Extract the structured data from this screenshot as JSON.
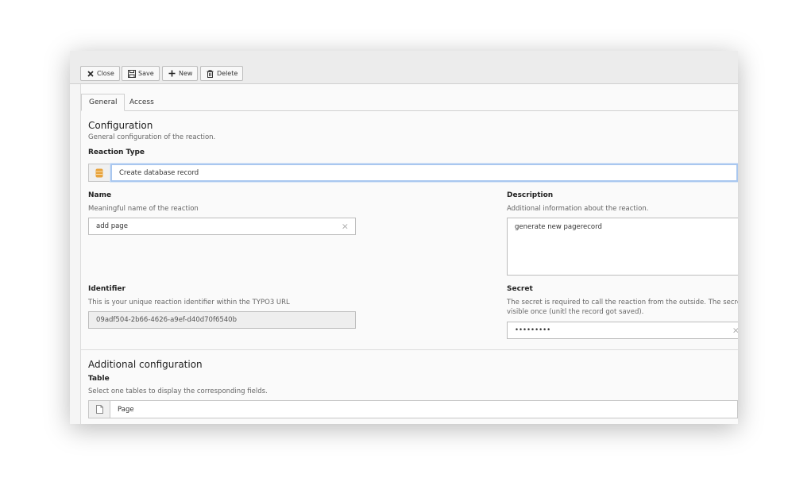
{
  "toolbar": {
    "close_label": "Close",
    "save_label": "Save",
    "new_label": "New",
    "delete_label": "Delete"
  },
  "tabs": [
    {
      "label": "General",
      "active": true
    },
    {
      "label": "Access",
      "active": false
    }
  ],
  "configuration": {
    "title": "Configuration",
    "subtitle": "General configuration of the reaction.",
    "reaction_type": {
      "label": "Reaction Type",
      "value": "Create database record",
      "icon": "database-icon"
    },
    "name": {
      "label": "Name",
      "description": "Meaningful name of the reaction",
      "value": "add page"
    },
    "description": {
      "label": "Description",
      "description": "Additional information about the reaction.",
      "value": "generate new pagerecord"
    },
    "identifier": {
      "label": "Identifier",
      "description": "This is your unique reaction identifier within the TYPO3 URL",
      "value": "09adf504-2b66-4626-a9ef-d40d70f6540b"
    },
    "secret": {
      "label": "Secret",
      "description_line1": "The secret is required to call the reaction from the outside. The secre",
      "description_line2": "visible once (unitl the record got saved).",
      "value": "•••••••••"
    }
  },
  "additional": {
    "title": "Additional configuration",
    "table": {
      "label": "Table",
      "description": "Select one tables to display the corresponding fields.",
      "value": "Page",
      "icon": "page-icon"
    }
  },
  "colors": {
    "focus": "#a9c7ef",
    "db_icon": "#e8a33d"
  }
}
